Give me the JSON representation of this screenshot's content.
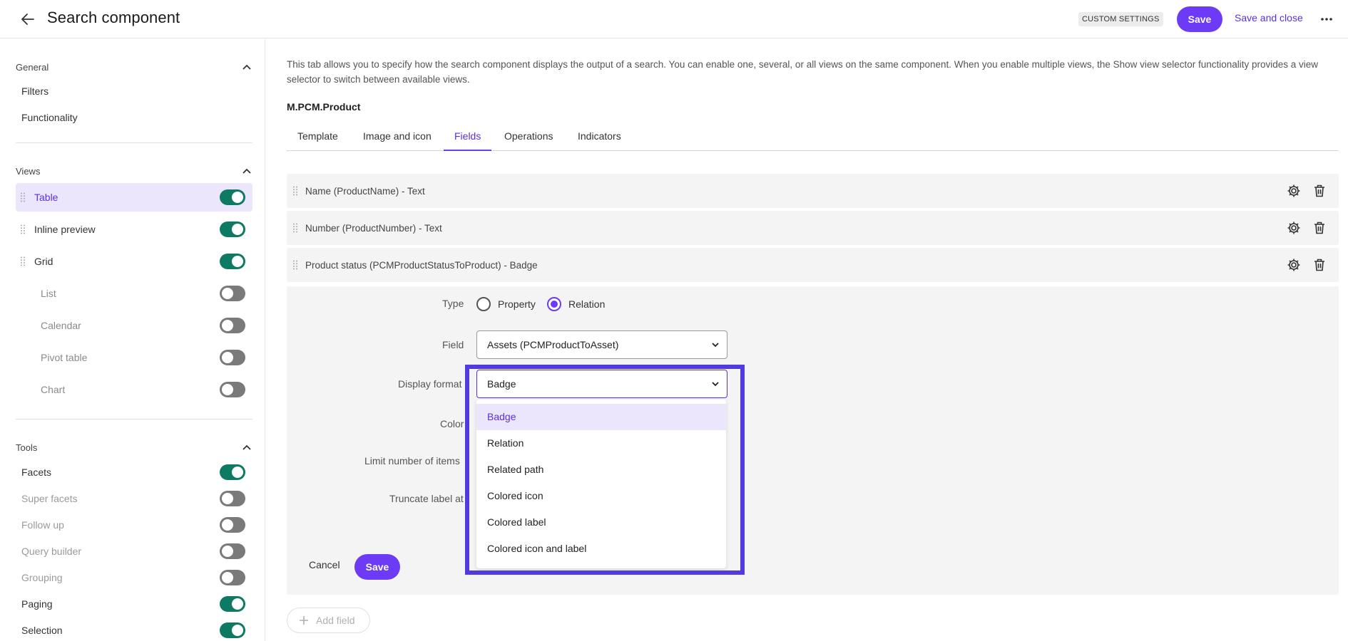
{
  "header": {
    "title": "Search component",
    "badge": "CUSTOM SETTINGS",
    "save_label": "Save",
    "save_close_label": "Save and close"
  },
  "sidebar": {
    "general": {
      "title": "General",
      "links": [
        "Filters",
        "Functionality"
      ]
    },
    "views": {
      "title": "Views",
      "items": [
        {
          "label": "Table",
          "enabled": true,
          "active": true
        },
        {
          "label": "Inline preview",
          "enabled": true
        },
        {
          "label": "Grid",
          "enabled": true
        },
        {
          "label": "List",
          "enabled": false
        },
        {
          "label": "Calendar",
          "enabled": false
        },
        {
          "label": "Pivot table",
          "enabled": false
        },
        {
          "label": "Chart",
          "enabled": false
        }
      ]
    },
    "tools": {
      "title": "Tools",
      "items": [
        {
          "label": "Facets",
          "enabled": true
        },
        {
          "label": "Super facets",
          "enabled": false
        },
        {
          "label": "Follow up",
          "enabled": false
        },
        {
          "label": "Query builder",
          "enabled": false
        },
        {
          "label": "Grouping",
          "enabled": false
        },
        {
          "label": "Paging",
          "enabled": true
        },
        {
          "label": "Selection",
          "enabled": true
        }
      ]
    }
  },
  "main": {
    "intro": "This tab allows you to specify how the search component displays the output of a search. You can enable one, several, or all views on the same component. When you enable multiple views, the Show view selector functionality provides a view selector to switch between available views.",
    "entity": "M.PCM.Product",
    "tabs": [
      "Template",
      "Image and icon",
      "Fields",
      "Operations",
      "Indicators"
    ],
    "active_tab": "Fields",
    "fields": [
      "Name (ProductName) - Text",
      "Number (ProductNumber) - Text",
      "Product status (PCMProductStatusToProduct) - Badge"
    ],
    "editor": {
      "type_label": "Type",
      "type_options": [
        "Property",
        "Relation"
      ],
      "type_selected": "Relation",
      "field_label": "Field",
      "field_value": "Assets (PCMProductToAsset)",
      "display_format_label": "Display format",
      "display_format_value": "Badge",
      "color_label": "Color",
      "limit_label": "Limit number of items",
      "truncate_label": "Truncate label at",
      "dropdown_options": [
        "Badge",
        "Relation",
        "Related path",
        "Colored icon",
        "Colored label",
        "Colored icon and label"
      ],
      "cancel_label": "Cancel",
      "save_label": "Save"
    },
    "add_field_label": "Add field"
  },
  "colors": {
    "accent": "#6d3bf5",
    "toggle_on": "#0e7a63",
    "toggle_off": "#7a7a7a",
    "highlight": "#4f3be0"
  }
}
